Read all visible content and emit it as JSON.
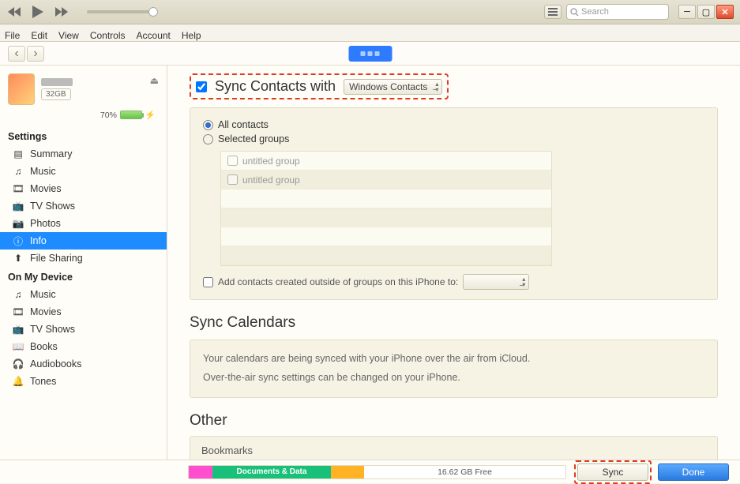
{
  "toolbar": {
    "search_placeholder": "Search"
  },
  "menus": [
    "File",
    "Edit",
    "View",
    "Controls",
    "Account",
    "Help"
  ],
  "device": {
    "capacity": "32GB",
    "battery_pct": "70%"
  },
  "sidebar": {
    "settings_heading": "Settings",
    "settings": [
      {
        "icon": "summary",
        "label": "Summary"
      },
      {
        "icon": "music",
        "label": "Music"
      },
      {
        "icon": "movies",
        "label": "Movies"
      },
      {
        "icon": "tv",
        "label": "TV Shows"
      },
      {
        "icon": "photos",
        "label": "Photos"
      },
      {
        "icon": "info",
        "label": "Info"
      },
      {
        "icon": "fileshare",
        "label": "File Sharing"
      }
    ],
    "onmydevice_heading": "On My Device",
    "onmydevice": [
      {
        "icon": "music",
        "label": "Music"
      },
      {
        "icon": "movies",
        "label": "Movies"
      },
      {
        "icon": "tv",
        "label": "TV Shows"
      },
      {
        "icon": "books",
        "label": "Books"
      },
      {
        "icon": "audiobooks",
        "label": "Audiobooks"
      },
      {
        "icon": "tones",
        "label": "Tones"
      }
    ]
  },
  "sync_contacts": {
    "title": "Sync Contacts with",
    "provider": "Windows Contacts",
    "all_label": "All contacts",
    "selected_label": "Selected groups",
    "groups": [
      "untitled group",
      "untitled group"
    ],
    "add_outside_label": "Add contacts created outside of groups on this iPhone to:"
  },
  "calendars": {
    "title": "Sync Calendars",
    "line1": "Your calendars are being synced with your iPhone over the air from iCloud.",
    "line2": "Over-the-air sync settings can be changed on your iPhone."
  },
  "other": {
    "title": "Other",
    "item": "Bookmarks"
  },
  "footer": {
    "docs_label": "Documents & Data",
    "free_label": "16.62 GB Free",
    "sync_label": "Sync",
    "done_label": "Done"
  }
}
